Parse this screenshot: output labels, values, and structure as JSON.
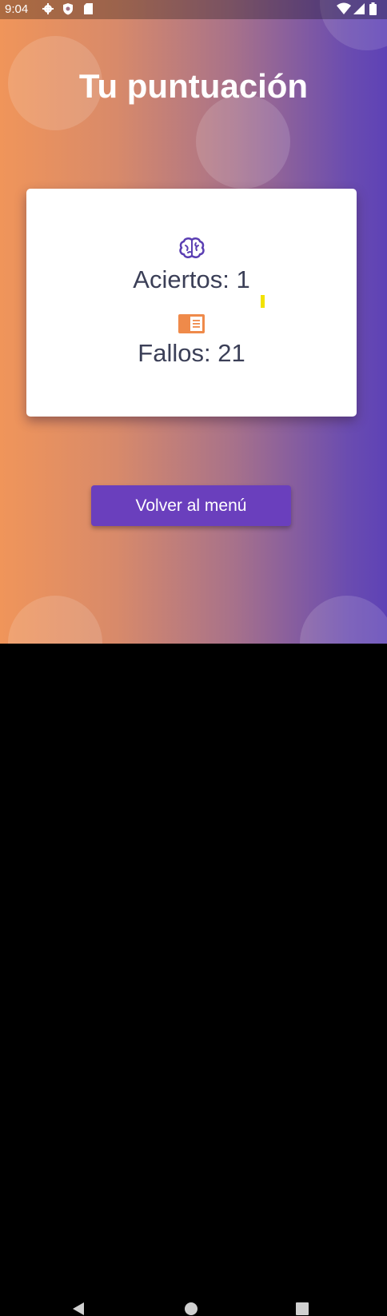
{
  "status_bar": {
    "time": "9:04",
    "icons": [
      "gear-icon",
      "shield-icon",
      "sd-card-icon",
      "wifi-icon",
      "signal-icon",
      "battery-icon"
    ]
  },
  "screen": {
    "title": "Tu puntuación"
  },
  "results": {
    "hits_label": "Aciertos: 1",
    "misses_label": "Fallos: 21",
    "hits_icon": "brain-icon",
    "misses_icon": "book-icon"
  },
  "actions": {
    "back_label": "Volver al menú"
  },
  "nav_bar": {
    "buttons": [
      "back-icon",
      "home-icon",
      "recents-icon"
    ]
  },
  "colors": {
    "gradient_start": "#f0955a",
    "gradient_end": "#5e42b6",
    "button": "#6a3fbd",
    "text_dark": "#3b3f57",
    "brain_icon": "#5b3fb3",
    "book_icon": "#ef8a4a"
  }
}
